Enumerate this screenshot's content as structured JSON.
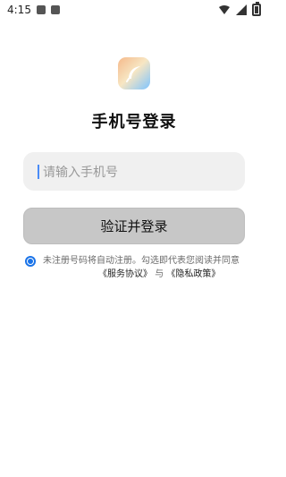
{
  "status_bar": {
    "time": "4:15",
    "icons": [
      "image-icon",
      "a-icon"
    ],
    "right_icons": [
      "wifi-icon",
      "signal-icon",
      "battery-icon"
    ]
  },
  "app": {
    "title": "手机号登录",
    "logo_icon": "feather-icon"
  },
  "login_form": {
    "phone_placeholder": "请输入手机号",
    "submit_label": "验证并登录"
  },
  "agreement": {
    "prefix": "未注册号码将自动注册。勾选即代表您阅读并同意",
    "terms_link": "《服务协议》",
    "joiner": "与",
    "privacy_link": "《隐私政策》",
    "checked": true
  },
  "colors": {
    "accent_blue": "#1a73e8",
    "button_gray": "#c7c7c7",
    "input_bg": "#f0f0f0"
  }
}
